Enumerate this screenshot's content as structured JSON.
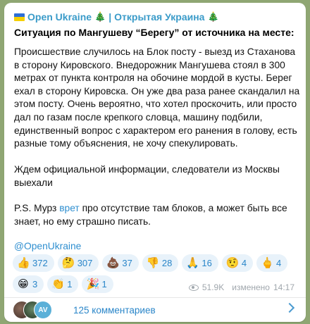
{
  "post": {
    "channel_name": "Open Ukraine",
    "channel_tree": "🎄",
    "channel_sep": "|",
    "channel_name_ru": "Открытая Украина",
    "headline": "Ситуация по Мангушеву “Берегу” от источника на месте:",
    "paragraph1": "Происшествие случилось на Блок посту - выезд из Стаханова в сторону Кировского. Внедорожник Мангушева стоял в 300 метрах от пункта контроля на обочине мордой в кусты. Берег ехал в сторону Кировска. Он уже два раза ранее скандалил на этом посту. Очень вероятно, что хотел проскочить, или просто дал по газам после крепкого словца, машину подбили, единственный вопрос с характером его ранения в голову, есть разные тому объяснения, не хочу спекулировать.",
    "paragraph2": "Ждем официальной информации, следователи из Москвы выехали",
    "ps_before": "P.S. Мурз ",
    "ps_link": "врет",
    "ps_after": " про отсутствие там блоков, а может быть все знает, но ему страшно писать.",
    "mention": "@OpenUkraine"
  },
  "reactions": [
    {
      "emoji": "👍",
      "count": "372"
    },
    {
      "emoji": "🤔",
      "count": "307"
    },
    {
      "emoji": "💩",
      "count": "37"
    },
    {
      "emoji": "👎",
      "count": "28"
    },
    {
      "emoji": "🙏",
      "count": "16"
    },
    {
      "emoji": "🤨",
      "count": "4"
    },
    {
      "emoji": "🖕",
      "count": "4"
    },
    {
      "emoji": "😁",
      "count": "3"
    },
    {
      "emoji": "👏",
      "count": "1"
    },
    {
      "emoji": "🎉",
      "count": "1"
    }
  ],
  "meta": {
    "views": "51.9K",
    "edited_label": "изменено",
    "time": "14:17"
  },
  "comments": {
    "avatar3_text": "AV",
    "label": "125 комментариев"
  }
}
